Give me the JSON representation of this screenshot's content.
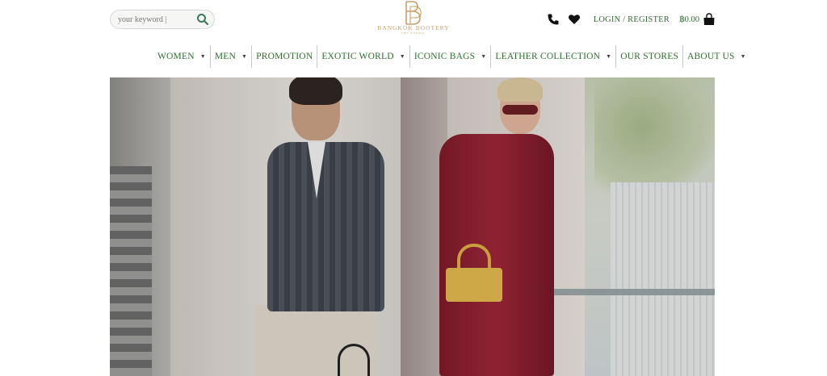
{
  "search": {
    "placeholder": "your keyword |"
  },
  "logo": {
    "name": "BANGKOK BOOTERY",
    "tagline": "THE EXOTIC"
  },
  "header": {
    "login_label": "LOGIN / REGISTER",
    "cart_total": "฿0.00"
  },
  "nav": {
    "items": [
      {
        "label": "WOMEN",
        "has_dropdown": true
      },
      {
        "label": "MEN",
        "has_dropdown": true
      },
      {
        "label": "PROMOTION",
        "has_dropdown": false
      },
      {
        "label": "EXOTIC WORLD",
        "has_dropdown": true
      },
      {
        "label": "ICONIC BAGS",
        "has_dropdown": true
      },
      {
        "label": "LEATHER COLLECTION",
        "has_dropdown": true
      },
      {
        "label": "OUR STORES",
        "has_dropdown": false
      },
      {
        "label": "ABOUT US",
        "has_dropdown": true
      }
    ],
    "caret": "▼"
  },
  "icons": {
    "search": "search-icon",
    "phone": "phone-icon",
    "wishlist": "heart-icon",
    "cart": "shopping-bag-icon",
    "logo": "bb-monogram-logo"
  },
  "colors": {
    "nav_text": "#2f6e2f",
    "logo_gold": "#c8a06a",
    "search_icon": "#3a7a5a"
  }
}
